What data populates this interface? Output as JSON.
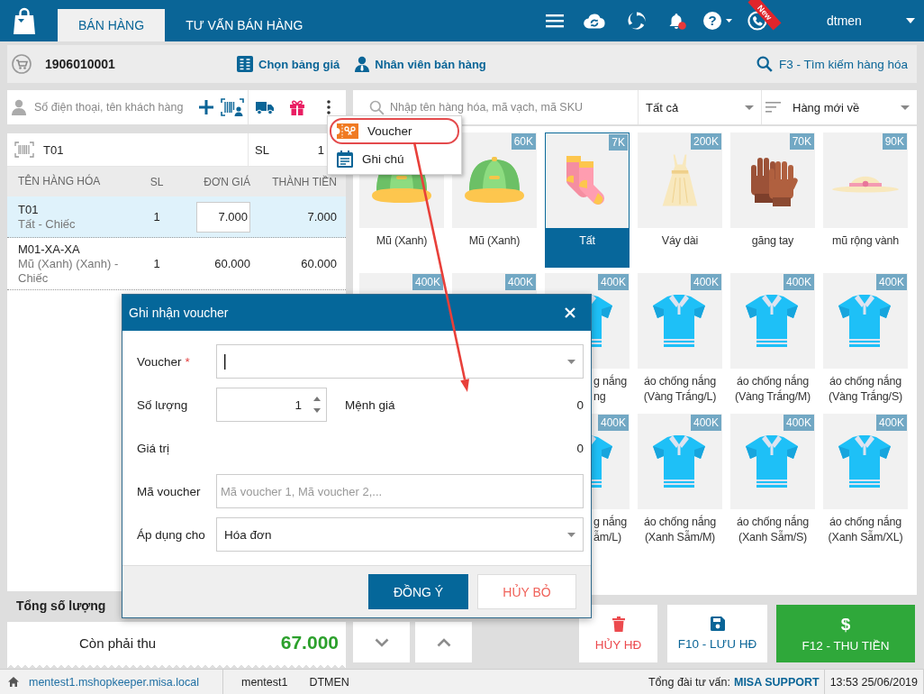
{
  "header": {
    "tabs": [
      {
        "label": "BÁN HÀNG",
        "selected": true
      },
      {
        "label": "TƯ VẤN BÁN HÀNG",
        "selected": false
      }
    ],
    "help": "?",
    "new_ribbon": "New",
    "user": "dtmen"
  },
  "toolbar": {
    "invoice_number": "1906010001",
    "price_list": "Chọn bảng giá",
    "staff": "Nhân viên bán hàng",
    "search_link": "F3 - Tìm kiếm hàng hóa"
  },
  "customer_search": {
    "placeholder": "Số điện thoại, tên khách hàng"
  },
  "more_menu": {
    "items": [
      {
        "kind": "voucher",
        "label": "Voucher",
        "highlighted": true
      },
      {
        "kind": "note",
        "label": "Ghi chú",
        "highlighted": false
      }
    ]
  },
  "barcode_entry": {
    "value": "T01",
    "qty_label": "SL",
    "qty": "1"
  },
  "order_table": {
    "columns": [
      "TÊN HÀNG HÓA",
      "SL",
      "ĐƠN GIÁ",
      "THÀNH TIỀN"
    ],
    "rows": [
      {
        "code": "T01",
        "description": "Tất - Chiếc",
        "qty": "1",
        "unit_price": "7.000",
        "amount": "7.000",
        "selected": true
      },
      {
        "code": "M01-XA-XA",
        "description": "Mũ (Xanh) (Xanh) - Chiếc",
        "qty": "1",
        "unit_price": "60.000",
        "amount": "60.000",
        "selected": false
      }
    ]
  },
  "totals": {
    "quantity_label": "Tổng số lượng",
    "due_label": "Còn phải thu",
    "due_amount": "67.000"
  },
  "product_search": {
    "placeholder": "Nhập tên hàng hóa, mã vạch, mã SKU",
    "category": "Tất cả",
    "sort": "Hàng mới về"
  },
  "product_grid": {
    "rows": [
      {
        "tiles": [
          {
            "kind": "cap_lower_part",
            "name": "Mũ (Xanh)",
            "selected": false,
            "covered": false
          },
          {
            "kind": "cap",
            "price": "60K",
            "name": "Mũ (Xanh)",
            "selected": false,
            "covered": false
          },
          {
            "kind": "socks",
            "price": "7K",
            "name": "Tất",
            "selected": true,
            "covered": false
          },
          {
            "kind": "dress",
            "price": "200K",
            "name": "Váy dài",
            "selected": false,
            "covered": false
          },
          {
            "kind": "gloves",
            "price": "70K",
            "name": "găng tay",
            "selected": false,
            "covered": false
          },
          {
            "kind": "sunhat",
            "price": "90K",
            "name": "mũ rộng vành",
            "selected": false,
            "covered": false
          }
        ]
      },
      {
        "tiles": [
          {
            "price": "400K",
            "selected": false
          },
          {
            "price": "400K",
            "selected": false
          },
          {
            "kind": "shirt",
            "price": "400K",
            "name": "g nắng\nng",
            "selected": false,
            "covered": true
          },
          {
            "kind": "shirt",
            "price": "400K",
            "name": "áo chống nắng (Vàng Trắng/L)",
            "selected": false,
            "covered": false
          },
          {
            "kind": "shirt",
            "price": "400K",
            "name": "áo chống nắng (Vàng Trắng/M)",
            "selected": false,
            "covered": false
          },
          {
            "kind": "shirt",
            "price": "400K",
            "name": "áo chống nắng (Vàng Trắng/S)",
            "selected": false,
            "covered": false
          }
        ]
      },
      {
        "tiles": [
          {
            "kind": "shirt",
            "price": "400K",
            "name": "g nắng\nẫm/L)",
            "selected": false,
            "covered": true
          },
          {
            "kind": "shirt",
            "price": "400K",
            "name": "áo chống nắng (Xanh Sẫm/M)",
            "selected": false,
            "covered": false
          },
          {
            "kind": "shirt",
            "price": "400K",
            "name": "áo chống nắng (Xanh Sẫm/S)",
            "selected": false,
            "covered": false
          },
          {
            "kind": "shirt",
            "price": "400K",
            "name": "áo chống nắng (Xanh Sẫm/XL)",
            "selected": false,
            "covered": false
          }
        ]
      }
    ]
  },
  "actions": [
    {
      "kind": "cancel",
      "label": "HỦY HĐ"
    },
    {
      "kind": "save",
      "label": "F10 - LƯU HĐ"
    },
    {
      "kind": "pay",
      "symbol": "$",
      "label": "F12 - THU TIỀN"
    }
  ],
  "voucher_dialog": {
    "title": "Ghi nhận voucher",
    "fields": [
      {
        "kind": "combo",
        "label": "Voucher",
        "required_mark": "*",
        "focused": true
      },
      {
        "kind": "spinner",
        "label": "Số lượng",
        "value": "1",
        "side_label": "Mệnh giá",
        "side_value": "0"
      },
      {
        "kind": "readout",
        "label": "Giá trị",
        "value": "0"
      },
      {
        "kind": "text",
        "label": "Mã voucher",
        "placeholder": "Mã voucher 1, Mã voucher 2,..."
      },
      {
        "kind": "combo",
        "label": "Áp dụng cho",
        "value": "Hóa đơn",
        "focused": false
      }
    ],
    "buttons": [
      {
        "kind": "primary",
        "label": "ĐỒNG Ý"
      },
      {
        "kind": "secondary",
        "label": "HỦY BỎ"
      }
    ]
  },
  "status_bar": {
    "host": "mentest1.mshopkeeper.misa.local",
    "user": "mentest1",
    "store": "DTMEN",
    "hotline_label": "Tổng đài tư vấn:",
    "hotline": "MISA SUPPORT",
    "datetime": "13:53 25/06/2019"
  }
}
